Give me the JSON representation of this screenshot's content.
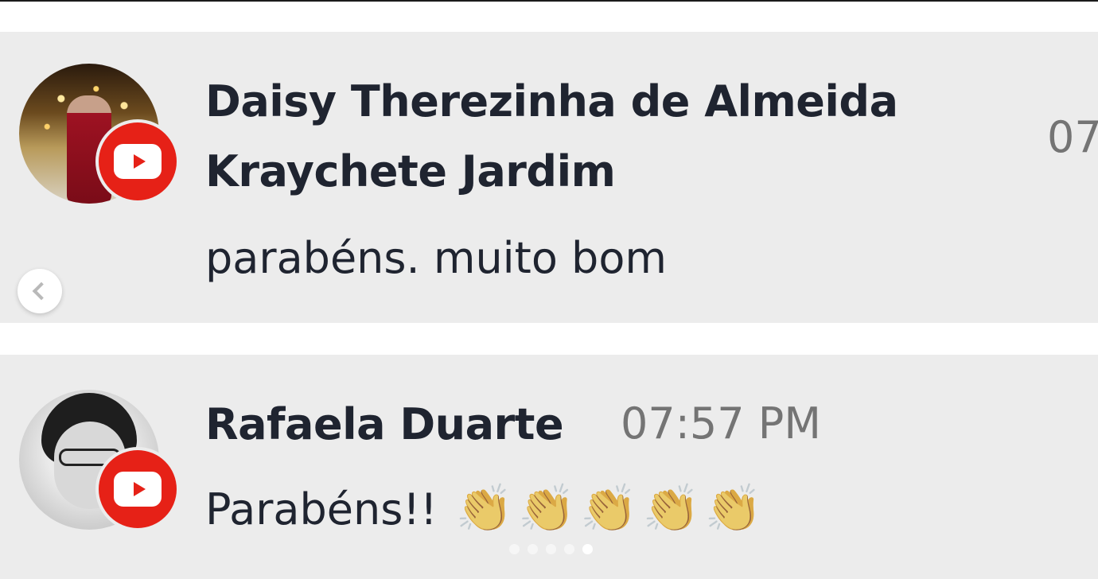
{
  "comments": [
    {
      "author": "Daisy Therezinha de Almeida Kraychete Jardim",
      "time": "07",
      "message": "parabéns. muito bom",
      "platform_icon": "youtube-icon"
    },
    {
      "author": "Rafaela Duarte",
      "time": "07:57 PM",
      "message": "Parabéns!!",
      "emoji": [
        "👏",
        "👏",
        "👏",
        "👏",
        "👏"
      ],
      "platform_icon": "youtube-icon"
    }
  ],
  "carousel": {
    "prev_icon": "chevron-left-icon",
    "total_slides": 5,
    "active_slide": 5
  },
  "colors": {
    "youtube_red": "#e62117",
    "card_bg": "#ececec",
    "author_text": "#1f2430",
    "time_text": "#747474"
  }
}
